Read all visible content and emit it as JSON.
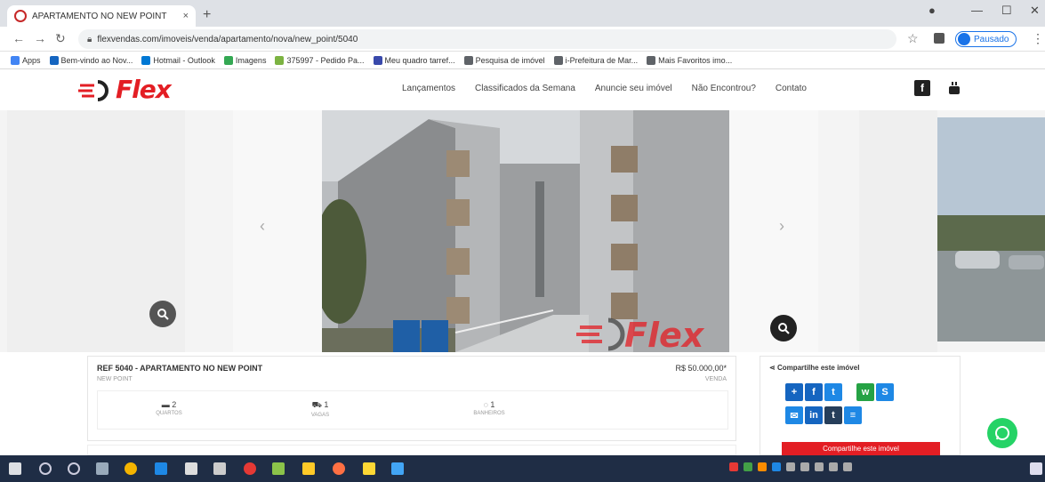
{
  "browser": {
    "tab_title": "APARTAMENTO NO NEW POINT",
    "tab_close": "×",
    "new_tab": "+",
    "url": "flexvendas.com/imoveis/venda/apartamento/nova/new_point/5040",
    "profile_label": "Pausado",
    "bookmarks": [
      {
        "label": "Apps",
        "color": "#4285f4"
      },
      {
        "label": "Bem-vindo ao Nov...",
        "color": "#1565c0"
      },
      {
        "label": "Hotmail - Outlook",
        "color": "#0078d4"
      },
      {
        "label": "Imagens",
        "color": "#34a853"
      },
      {
        "label": "375997 - Pedido Pa...",
        "color": "#7cb342"
      },
      {
        "label": "Meu quadro tarref...",
        "color": "#3949ab"
      },
      {
        "label": "Pesquisa de imóvel",
        "color": "#5f6368"
      },
      {
        "label": "i-Prefeitura de Mar...",
        "color": "#5f6368"
      },
      {
        "label": "Mais Favoritos imo...",
        "color": "#5f6368"
      }
    ]
  },
  "site": {
    "logo_text": "Flex",
    "brand_color": "#e31e24",
    "nav": [
      "Lançamentos",
      "Classificados da Semana",
      "Anuncie seu imóvel",
      "Não Encontrou?",
      "Contato"
    ],
    "social": {
      "facebook": "f",
      "youtube": "You"
    }
  },
  "listing": {
    "title": "REF 5040 - APARTAMENTO NO NEW POINT",
    "subtitle": "NEW POINT",
    "price": "R$ 50.000,00*",
    "type": "VENDA",
    "features": [
      {
        "icon": "bed-icon",
        "value": "2",
        "label": "QUARTOS"
      },
      {
        "icon": "car-icon",
        "value": "1",
        "label": "VAGAS"
      },
      {
        "icon": "bath-icon",
        "value": "1",
        "label": "BANHEIROS"
      }
    ]
  },
  "share": {
    "title": "Compartilhe este imóvel",
    "buttons": [
      {
        "name": "plus",
        "glyph": "+",
        "color": "#1565c0"
      },
      {
        "name": "facebook",
        "glyph": "f",
        "color": "#1565c0"
      },
      {
        "name": "twitter",
        "glyph": "t",
        "color": "#1e88e5"
      },
      {
        "name": "whatsapp",
        "glyph": "w",
        "color": "#25a244"
      },
      {
        "name": "skype",
        "glyph": "S",
        "color": "#1e88e5"
      },
      {
        "name": "email",
        "glyph": "✉",
        "color": "#1e88e5"
      },
      {
        "name": "linkedin",
        "glyph": "in",
        "color": "#1565c0"
      },
      {
        "name": "tumblr",
        "glyph": "t",
        "color": "#263e5a"
      },
      {
        "name": "message",
        "glyph": "≡",
        "color": "#1e88e5"
      }
    ],
    "cta": "Compartilhe este imóvel"
  }
}
